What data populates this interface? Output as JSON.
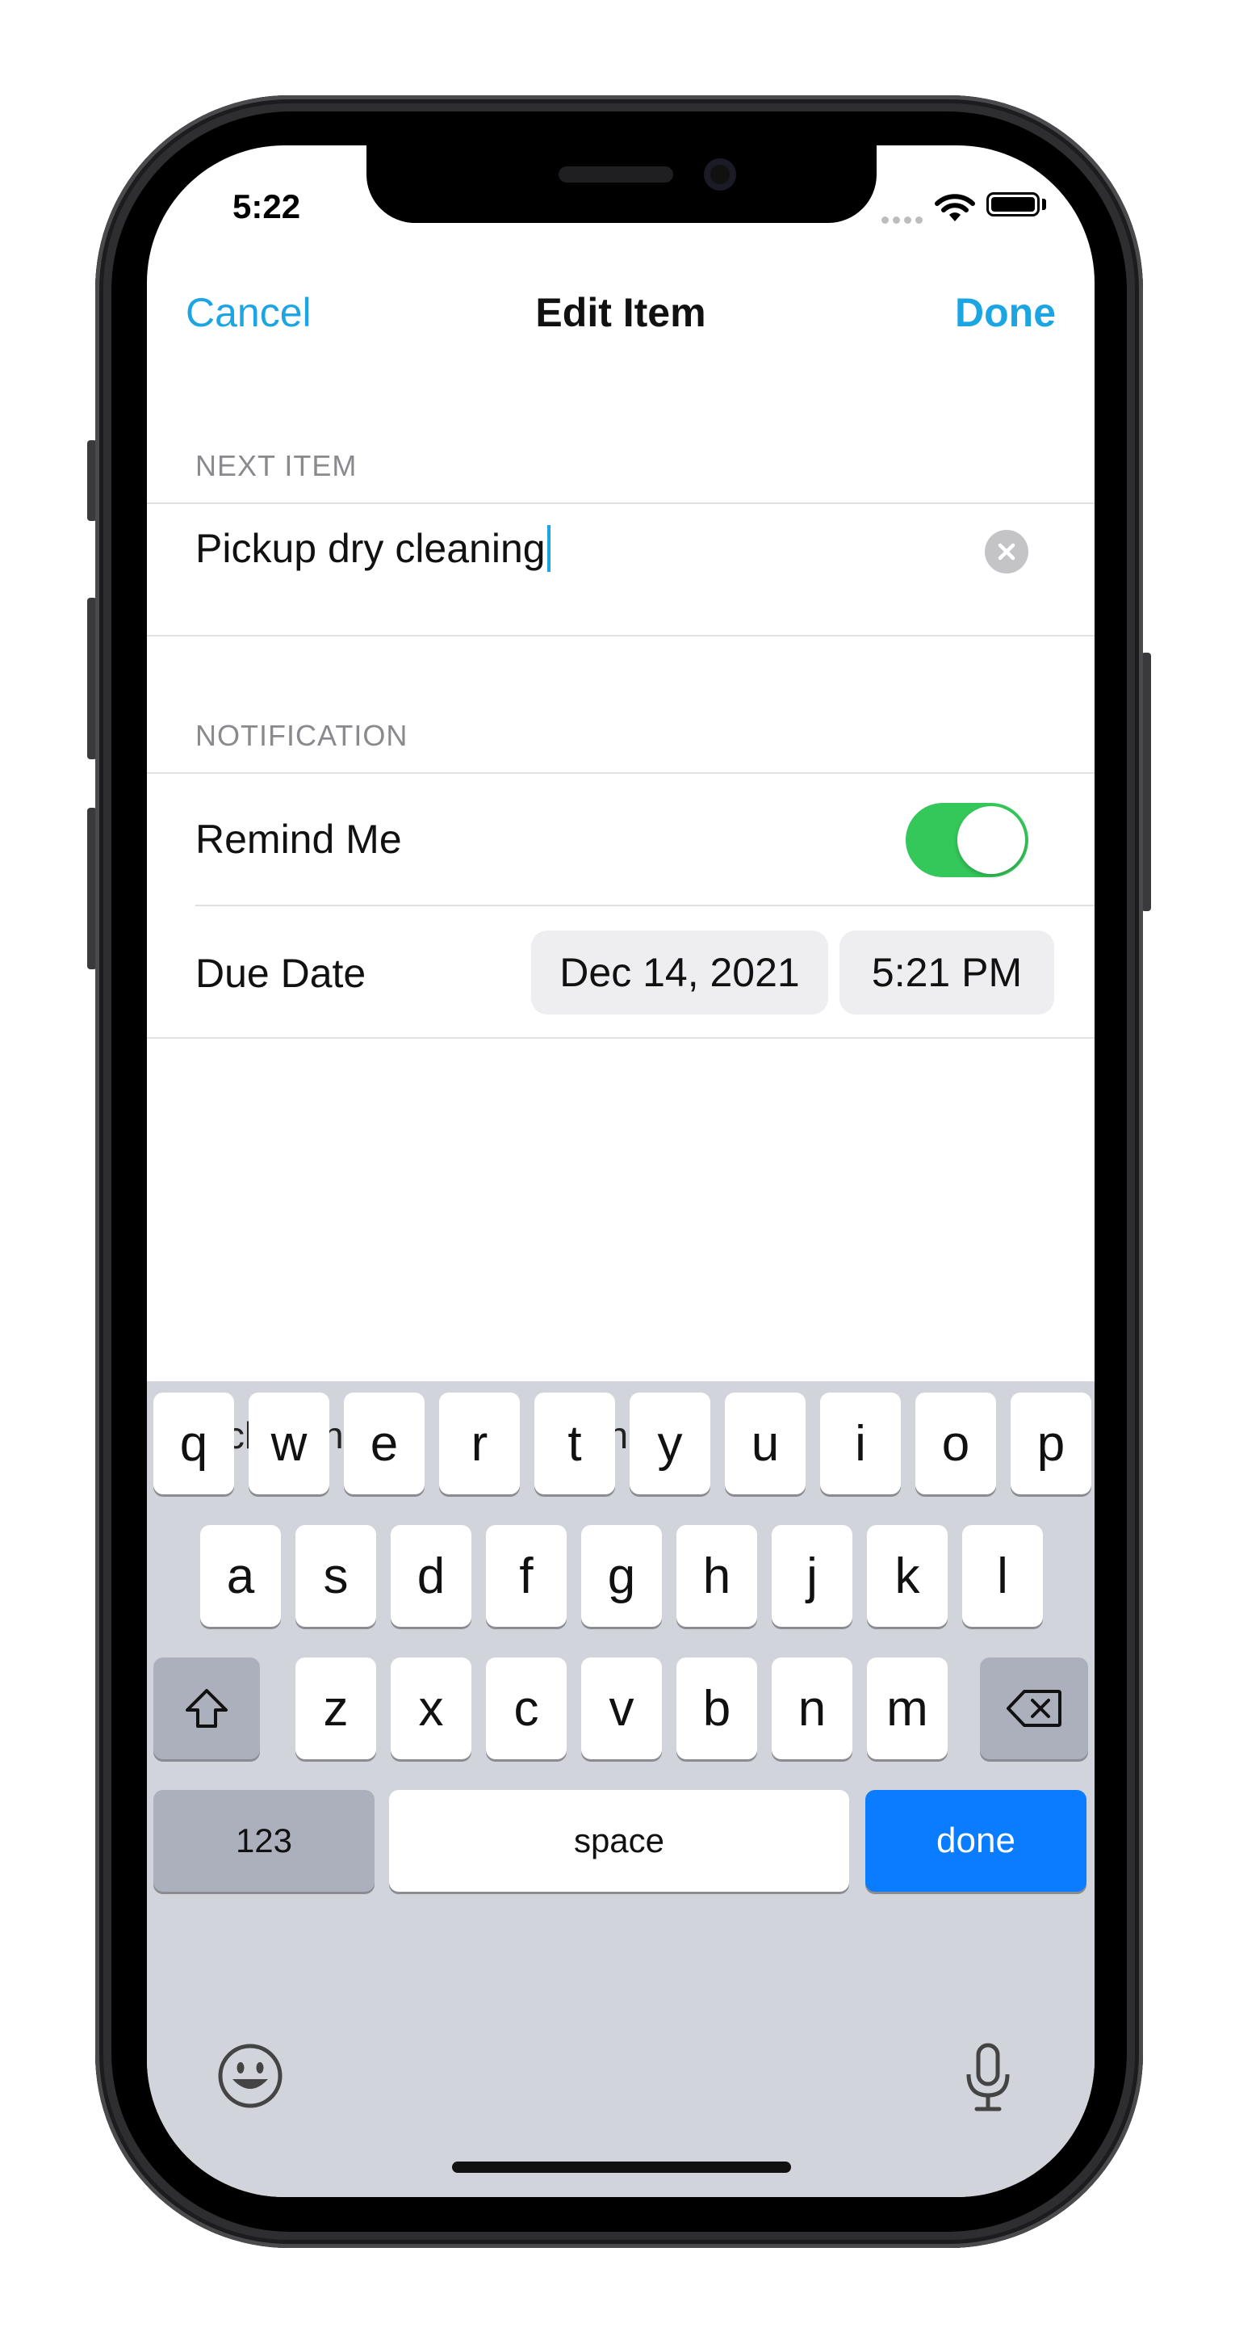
{
  "status_bar": {
    "time": "5:22",
    "wifi_icon": "wifi-icon",
    "battery_icon": "battery-icon"
  },
  "nav": {
    "cancel_label": "Cancel",
    "title": "Edit Item",
    "done_label": "Done",
    "accent": "#1ca5e3"
  },
  "next_item": {
    "header": "NEXT ITEM",
    "value": "Pickup dry cleaning",
    "clear_icon": "clear-icon"
  },
  "notification": {
    "header": "NOTIFICATION",
    "remind_label": "Remind Me",
    "remind_on": true,
    "toggle_color": "#34c759",
    "due_label": "Due Date",
    "due_date": "Dec 14, 2021",
    "due_time": "5:21 PM"
  },
  "keyboard": {
    "suggestions": [
      "cleanings",
      "cleaning’s",
      ""
    ],
    "row1": [
      "q",
      "w",
      "e",
      "r",
      "t",
      "y",
      "u",
      "i",
      "o",
      "p"
    ],
    "row2": [
      "a",
      "s",
      "d",
      "f",
      "g",
      "h",
      "j",
      "k",
      "l"
    ],
    "row3": [
      "z",
      "x",
      "c",
      "v",
      "b",
      "n",
      "m"
    ],
    "numbers_label": "123",
    "space_label": "space",
    "done_label": "done",
    "done_color": "#0a7cff",
    "emoji_icon": "emoji-icon",
    "mic_icon": "microphone-icon",
    "shift_icon": "shift-icon",
    "delete_icon": "backspace-icon"
  }
}
